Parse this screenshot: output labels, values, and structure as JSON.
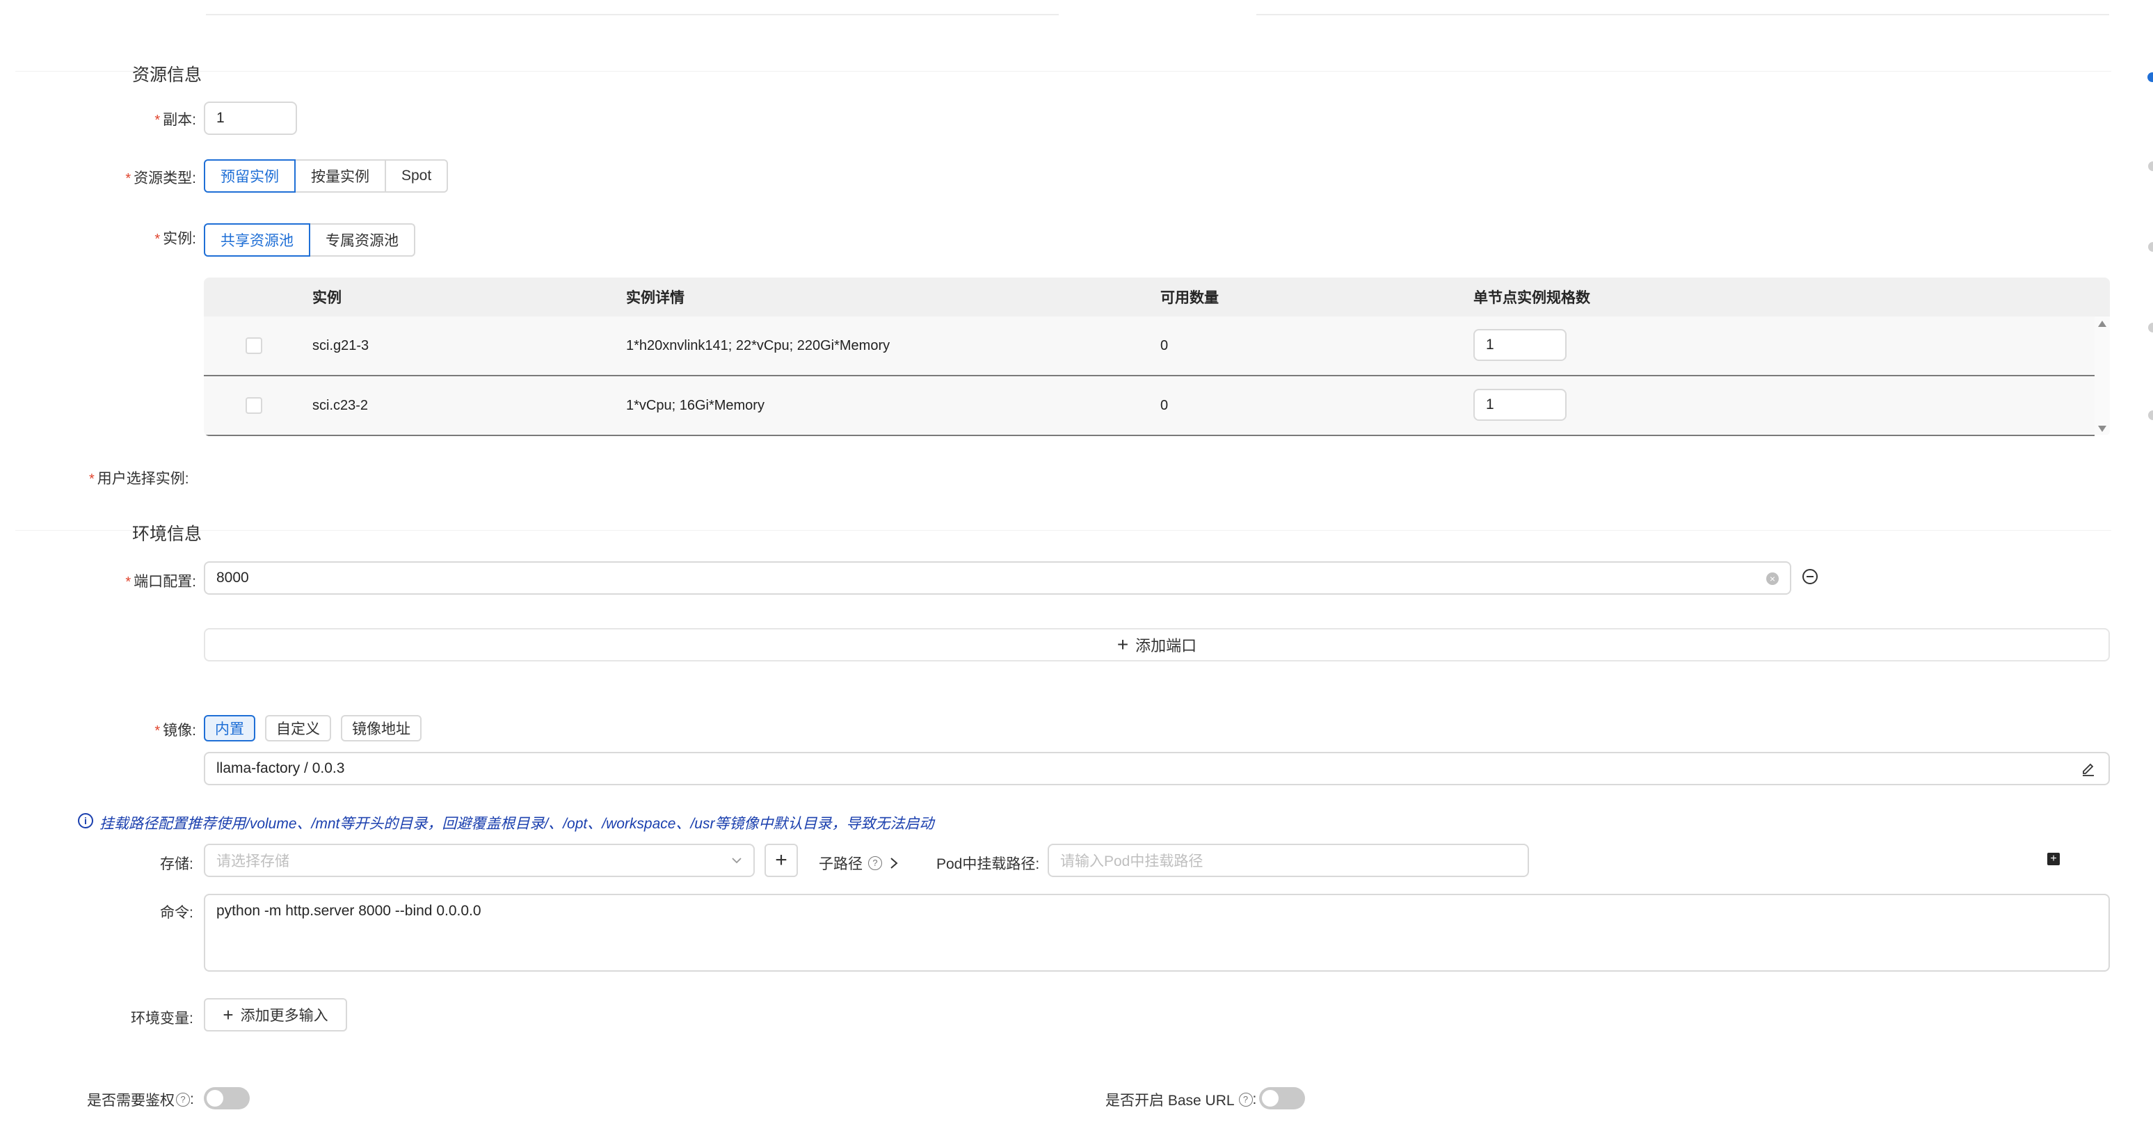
{
  "resource": {
    "section_title": "资源信息",
    "replicas": {
      "label": "副本:",
      "value": "1"
    },
    "resource_type": {
      "label": "资源类型:",
      "options": [
        "预留实例",
        "按量实例",
        "Spot"
      ],
      "selected": "预留实例"
    },
    "instance": {
      "label": "实例:",
      "options": [
        "共享资源池",
        "专属资源池"
      ],
      "selected": "共享资源池"
    },
    "table": {
      "headers": [
        "实例",
        "实例详情",
        "可用数量",
        "单节点实例规格数"
      ],
      "rows": [
        {
          "name": "sci.g21-3",
          "detail": "1*h20xnvlink141; 22*vCpu; 220Gi*Memory",
          "available": "0",
          "spec": "1"
        },
        {
          "name": "sci.c23-2",
          "detail": "1*vCpu; 16Gi*Memory",
          "available": "0",
          "spec": "1"
        }
      ]
    },
    "user_selected_label": "用户选择实例:"
  },
  "environment": {
    "section_title": "环境信息",
    "port": {
      "label": "端口配置:",
      "value": "8000",
      "add_label": "添加端口"
    },
    "image": {
      "label": "镜像:",
      "options": [
        "内置",
        "自定义",
        "镜像地址"
      ],
      "selected": "内置",
      "value": "llama-factory / 0.0.3"
    },
    "mount_notice": "挂载路径配置推荐使用/volume、/mnt等开头的目录，回避覆盖根目录/、/opt、/workspace、/usr等镜像中默认目录，导致无法启动",
    "storage": {
      "label": "存储:",
      "placeholder": "请选择存储",
      "subpath_label": "子路径",
      "pod_path_label": "Pod中挂载路径:",
      "pod_path_placeholder": "请输入Pod中挂载路径"
    },
    "command": {
      "label": "命令:",
      "value": "python -m http.server 8000 --bind 0.0.0.0"
    },
    "env_vars": {
      "label": "环境变量:",
      "add_label": "添加更多输入"
    },
    "auth": {
      "label": "是否需要鉴权",
      "enabled": false
    },
    "base_url": {
      "label": "是否开启 Base URL",
      "enabled": false
    }
  },
  "colors": {
    "primary": "#1f6fd6",
    "required": "#e0442d",
    "notice": "#1a3fae"
  }
}
